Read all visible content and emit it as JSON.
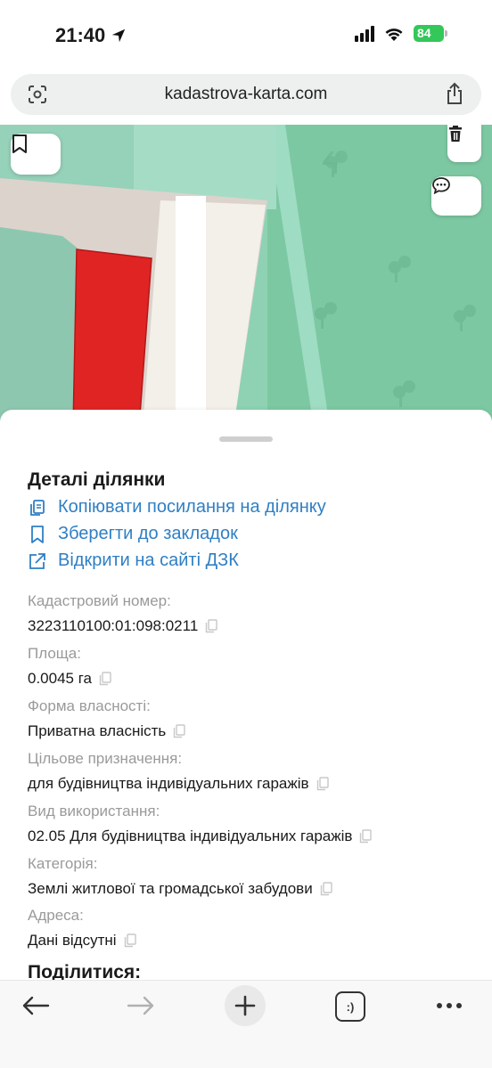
{
  "status": {
    "time": "21:40",
    "battery": "84"
  },
  "browser": {
    "url": "kadastrova-karta.com",
    "tabs_label": ":)"
  },
  "map": {
    "colors": {
      "green": "#7cc8a2",
      "light_green": "#9edcc3",
      "parcel_red": "#e02424",
      "road": "#f3efe9",
      "building": "#dcd3cd"
    }
  },
  "sheet": {
    "title": "Деталі ділянки",
    "actions": [
      {
        "label": "Копіювати посилання на ділянку",
        "icon": "copy-link-icon"
      },
      {
        "label": "Зберегти до закладок",
        "icon": "bookmark-icon"
      },
      {
        "label": "Відкрити на сайті ДЗК",
        "icon": "external-link-icon"
      }
    ],
    "fields": [
      {
        "label": "Кадастровий номер:",
        "value": "3223110100:01:098:0211"
      },
      {
        "label": "Площа:",
        "value": "0.0045 га"
      },
      {
        "label": "Форма власності:",
        "value": "Приватна власність"
      },
      {
        "label": "Цільове призначення:",
        "value": "для будівництва індивідуальних гаражів"
      },
      {
        "label": "Вид використання:",
        "value": "02.05 Для будівництва індивідуальних гаражів"
      },
      {
        "label": "Категорія:",
        "value": "Землі житлової та громадської забудови"
      },
      {
        "label": "Адреса:",
        "value": "Дані відсутні"
      }
    ],
    "share_title": "Поділитися:"
  },
  "accent_color": "#2f7fc4"
}
